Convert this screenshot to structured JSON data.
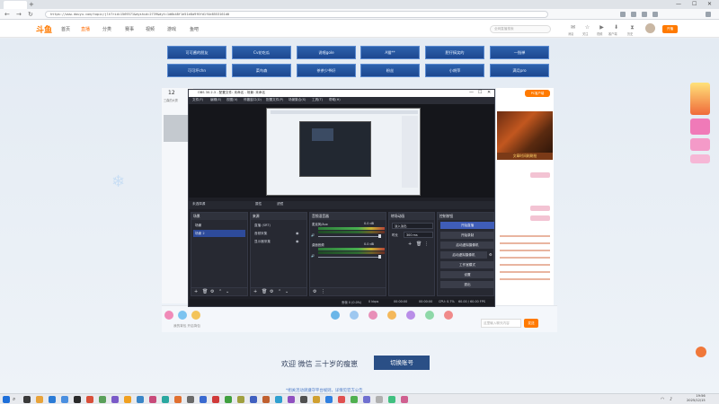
{
  "browser": {
    "url": "https://www.douyu.com/topic/jlh?rid=1569371&dyshid=2739&dyt=1d6b48f1e51e8a9f6fd1f4e8553161d0",
    "buttons": {
      "minimize": "—",
      "maximize": "☐",
      "close": "✕",
      "new_tab": "+"
    },
    "nav": {
      "back": "←",
      "forward": "→",
      "refresh": "↻"
    }
  },
  "site": {
    "logo": "斗鱼",
    "nav": [
      "首页",
      "直播",
      "分类",
      "赛事",
      "视频",
      "游戏",
      "鱼吧"
    ],
    "search_placeholder": "全网直播搜索",
    "header_icons": [
      {
        "icon": "✉",
        "label": "消息"
      },
      {
        "icon": "☆",
        "label": "关注"
      },
      {
        "icon": "▶",
        "label": "视频"
      },
      {
        "icon": "⬇",
        "label": "客户端"
      },
      {
        "icon": "⧗",
        "label": "历史"
      }
    ],
    "start_live": "开播"
  },
  "tiles": [
    [
      "可可酱的朋友",
      "Cv花吃瓜",
      "说唱gole",
      "A猫**",
      "肥仔搞笑的",
      "一指禅"
    ],
    [
      "可可坏chn",
      "菜鸟森",
      "茶茶少爷好",
      "粉丝",
      "小胡萍",
      "满月pro"
    ]
  ],
  "room": {
    "number": "12",
    "sub": "三森的大秀",
    "pc_btn": "PC客户端",
    "banner_text": "文章时间刷刷抢",
    "chat_placeholder": "这里输入聊天内容",
    "send": "发送",
    "gift_label": "我的背包 开启背包"
  },
  "obs": {
    "title": "OBS 30.2.3 - 配置文件: 未命名 - 场景: 未命名",
    "menu": [
      "文件(F)",
      "编辑(E)",
      "视图(V)",
      "停靠窗口(D)",
      "配置文件(P)",
      "场景集合(S)",
      "工具(T)",
      "帮助(H)"
    ],
    "toolbar": {
      "no_source": "未选择源",
      "properties": "属性",
      "filters": "滤镜"
    },
    "docks": {
      "scenes": "场景",
      "sources": "来源",
      "mixer": "音频混音器",
      "transitions": "转场动画",
      "controls": "控制按钮"
    },
    "scenes": [
      "场景",
      "场景 2"
    ],
    "sources": [
      "直播 (SRT)",
      "音频采集",
      "显示器采集"
    ],
    "mixer": [
      {
        "name": "麦克风/Aux",
        "level": "0.0 dB"
      },
      {
        "name": "桌面音频",
        "level": "0.0 dB"
      }
    ],
    "transition": {
      "type": "淡入淡出",
      "duration_label": "时长",
      "duration": "300 ms"
    },
    "controls": [
      "开始直播",
      "开始录制",
      "启动虚拟摄像机",
      "启动虚拟摄像机",
      "工作室模式",
      "设置",
      "退出"
    ],
    "status": {
      "dropped": "丢帧 0 (0.0%)",
      "kbps": "0 kbps",
      "live": "00:00:00",
      "rec": "00:00:00",
      "cpu": "CPU: 0.7%",
      "fps": "60.00 / 60.00 FPS"
    }
  },
  "welcome": {
    "text": "欢迎   微信  三十岁的瘦崽",
    "button": "切换账号",
    "notice": "*相关活动请遵守平台规则，详情见官方公告"
  },
  "taskbar": {
    "time": "19:56",
    "date": "2025/12/15"
  },
  "colors": {
    "accent": "#ff7a00",
    "obs_selected": "#2e4b9b",
    "obs_primary": "#3f5db8",
    "tile": "#1d4890"
  }
}
